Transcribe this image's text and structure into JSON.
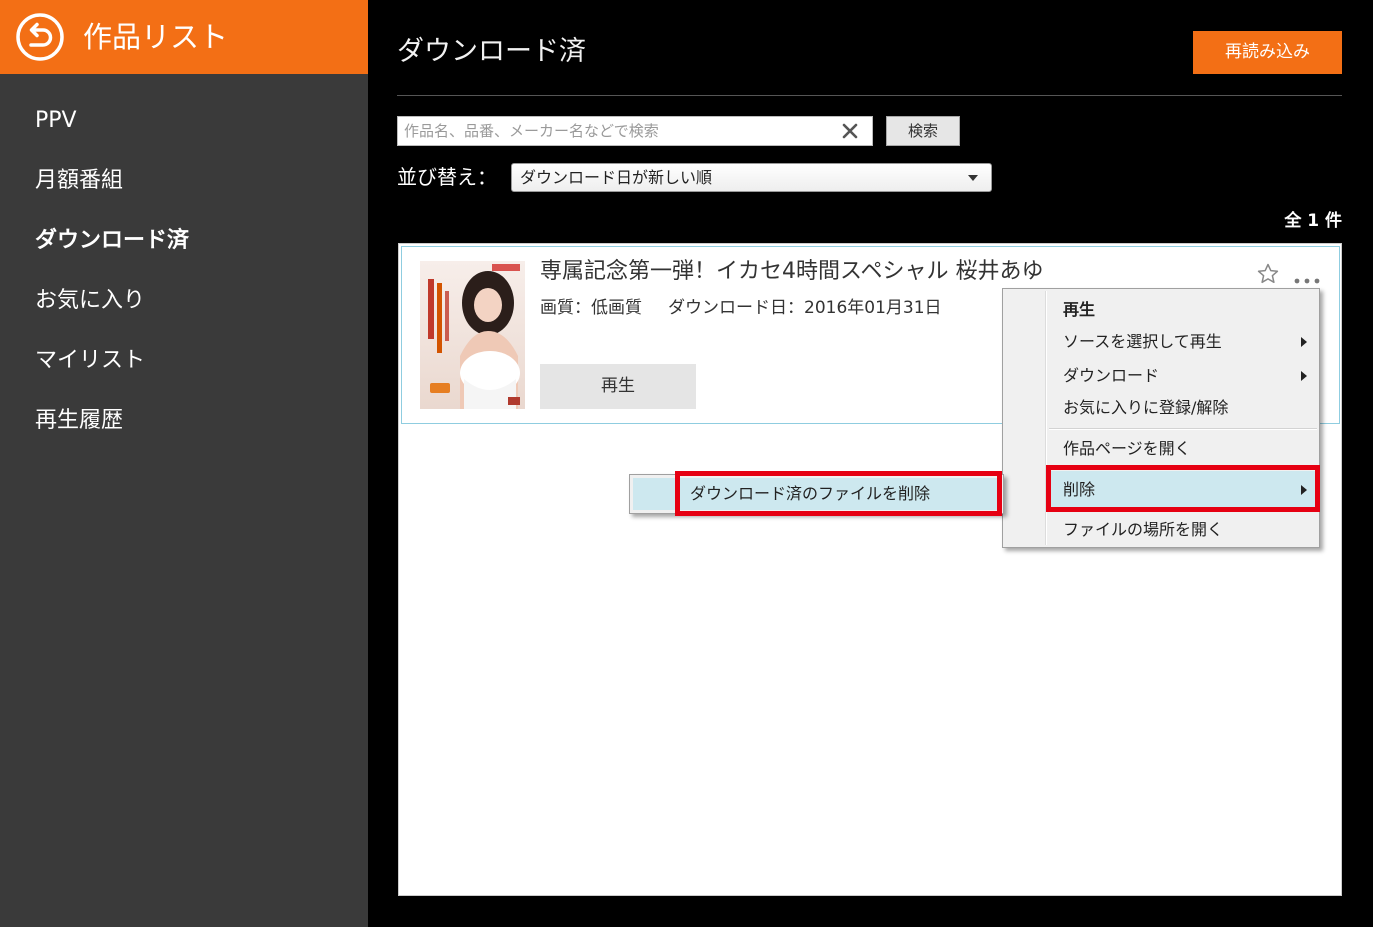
{
  "sidebar": {
    "header_title": "作品リスト",
    "back_icon": "back-arrow-circle-icon",
    "items": [
      {
        "label": "PPV",
        "active": false
      },
      {
        "label": "月額番組",
        "active": false
      },
      {
        "label": "ダウンロード済",
        "active": true
      },
      {
        "label": "お気に入り",
        "active": false
      },
      {
        "label": "マイリスト",
        "active": false
      },
      {
        "label": "再生履歴",
        "active": false
      }
    ]
  },
  "main": {
    "title": "ダウンロード済",
    "reload_label": "再読み込み",
    "search": {
      "placeholder": "作品名、品番、メーカー名などで検索",
      "value": "",
      "clear_icon": "close-icon",
      "button_label": "検索"
    },
    "sort": {
      "label": "並び替え：",
      "selected": "ダウンロード日が新しい順",
      "dropdown_icon": "triangle-down-icon"
    },
    "count_label": "全 1 件",
    "items": [
      {
        "title": "専属記念第一弾！イカセ4時間スペシャル 桜井あゆ",
        "quality": "画質：低画質",
        "download_date": "ダウンロード日：2016年01月31日",
        "play_label": "再生",
        "favorite_icon": "star-outline-icon",
        "more_icon": "more-dots-icon"
      }
    ]
  },
  "context_menu": {
    "items": [
      {
        "label": "再生",
        "default": true,
        "has_submenu": false,
        "highlighted": false
      },
      {
        "label": "ソースを選択して再生",
        "has_submenu": true,
        "highlighted": false
      },
      {
        "label": "ダウンロード",
        "has_submenu": true,
        "highlighted": false
      },
      {
        "label": "お気に入りに登録/解除",
        "has_submenu": false,
        "highlighted": false
      },
      {
        "label": "作品ページを開く",
        "has_submenu": false,
        "highlighted": false
      },
      {
        "label": "削除",
        "has_submenu": true,
        "highlighted": true
      },
      {
        "label": "ファイルの場所を開く",
        "has_submenu": false,
        "highlighted": false
      }
    ],
    "submenu": {
      "items": [
        {
          "label": "ダウンロード済のファイルを削除",
          "highlighted": true
        }
      ]
    }
  },
  "colors": {
    "accent": "#f36f15",
    "sidebar_bg": "#3a3a3a",
    "page_bg": "#000000",
    "menu_bg": "#f0f0f0",
    "menu_highlight": "#cde8ef",
    "card_border": "#8fcde0",
    "annotation_red": "#e60012"
  }
}
